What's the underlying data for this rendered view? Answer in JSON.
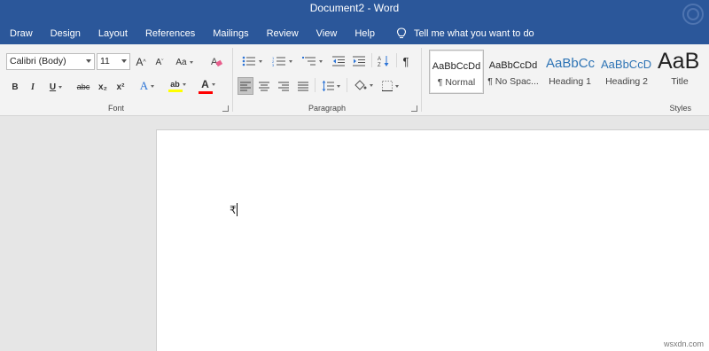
{
  "window": {
    "title": "Document2  -  Word"
  },
  "tabs": [
    "Draw",
    "Design",
    "Layout",
    "References",
    "Mailings",
    "Review",
    "View",
    "Help"
  ],
  "tell_me": "Tell me what you want to do",
  "font": {
    "name_value": "Calibri (Body)",
    "size_value": "11",
    "case_label": "Aa",
    "bold": "B",
    "italic": "I",
    "underline": "U",
    "strike": "abc",
    "subscript": "x₂",
    "superscript": "x²",
    "grow": "A",
    "shrink": "A",
    "effects": "A",
    "highlight": "ab",
    "color": "A",
    "highlight_color": "#ffff00",
    "font_color": "#ff0000",
    "group_label": "Font"
  },
  "paragraph": {
    "group_label": "Paragraph",
    "pilcrow": "¶"
  },
  "styles": {
    "group_label": "Styles",
    "items": [
      {
        "sample": "AaBbCcDd",
        "name": "¶ Normal"
      },
      {
        "sample": "AaBbCcDd",
        "name": "¶ No Spac..."
      },
      {
        "sample": "AaBbCc",
        "name": "Heading 1"
      },
      {
        "sample": "AaBbCcD",
        "name": "Heading 2"
      },
      {
        "sample": "AaB",
        "name": "Title"
      }
    ]
  },
  "document": {
    "typed_text": "₹"
  },
  "watermark": "wsxdn.com"
}
